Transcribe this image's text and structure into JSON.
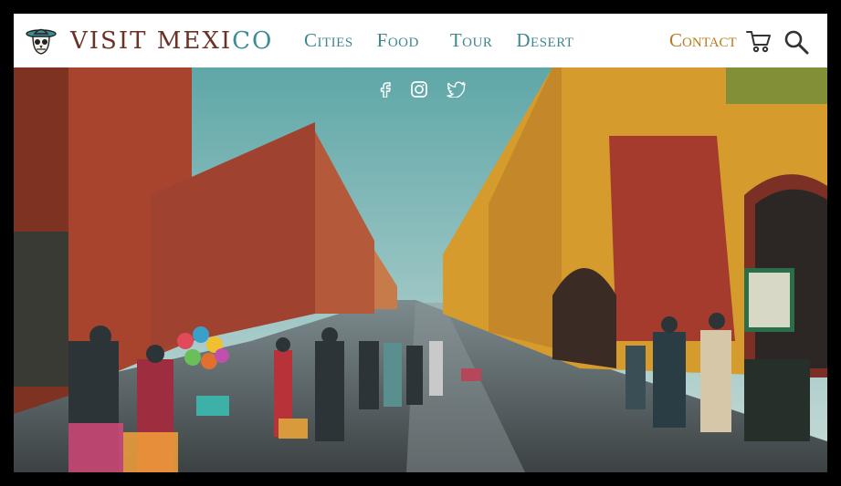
{
  "brand": {
    "name_a": "VISIT MEXI",
    "name_b": "CO",
    "logo_icon": "sombrero-skull-icon"
  },
  "nav": {
    "items": [
      {
        "label": "Cities"
      },
      {
        "label": "Food"
      },
      {
        "label": "Tour"
      },
      {
        "label": "Desert"
      }
    ]
  },
  "contact_label": "Contact",
  "icons": {
    "cart": "shopping-cart-icon",
    "search": "search-icon",
    "social": [
      "facebook-icon",
      "instagram-icon",
      "twitter-icon"
    ]
  },
  "colors": {
    "brand": "#6b3327",
    "nav": "#3f8790",
    "contact": "#b87b1c",
    "frame": "#000000"
  },
  "hero": {
    "description_visible": false
  }
}
